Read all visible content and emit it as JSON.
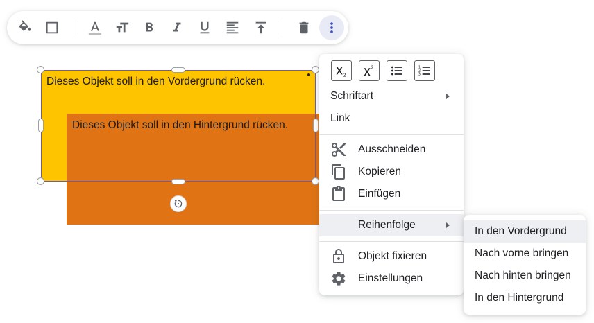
{
  "toolbar": {
    "buttons": [
      "fill-color",
      "border",
      "text-color",
      "font-size",
      "bold",
      "italic",
      "underline",
      "align",
      "vertical-align",
      "delete",
      "more"
    ],
    "text_color_underline": "#bdbdbd",
    "active_bg": "#e8eaf6",
    "active_icon_color": "#3f51b5"
  },
  "canvas": {
    "front_text": "Dieses Objekt soll in den Vordergrund rücken.",
    "back_text": "Dieses Objekt soll in den Hintergrund rücken.",
    "front_color": "#ffc400",
    "back_color": "#e07415",
    "selection_color": "#6a5bb5"
  },
  "context_menu": {
    "format_buttons": [
      "subscript-icon",
      "superscript-icon",
      "bulleted-list-icon",
      "numbered-list-icon"
    ],
    "items": {
      "font": "Schriftart",
      "link": "Link",
      "cut": "Ausschneiden",
      "copy": "Kopieren",
      "paste": "Einfügen",
      "order": "Reihenfolge",
      "lock": "Objekt fixieren",
      "settings": "Einstellungen"
    }
  },
  "order_submenu": {
    "items": [
      "In den Vordergrund",
      "Nach vorne bringen",
      "Nach hinten bringen",
      "In den Hintergrund"
    ]
  }
}
